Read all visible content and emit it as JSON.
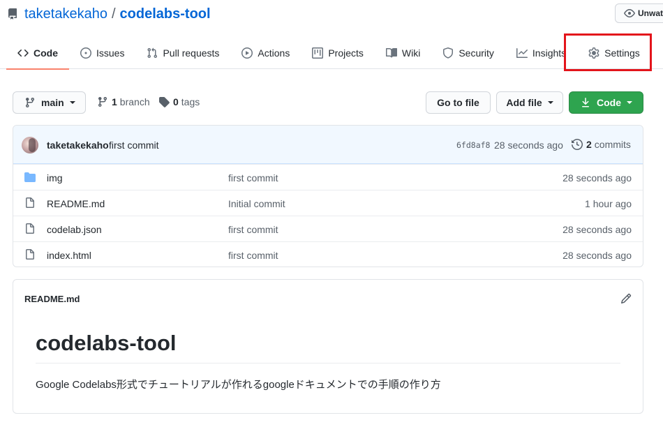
{
  "repo": {
    "owner": "taketakekaho",
    "separator": "/",
    "name": "codelabs-tool",
    "watch_label": "Unwatch"
  },
  "tabs": [
    {
      "label": "Code",
      "icon": "code-icon",
      "active": true
    },
    {
      "label": "Issues",
      "icon": "issue-icon"
    },
    {
      "label": "Pull requests",
      "icon": "pull-request-icon"
    },
    {
      "label": "Actions",
      "icon": "play-icon"
    },
    {
      "label": "Projects",
      "icon": "project-icon"
    },
    {
      "label": "Wiki",
      "icon": "book-icon"
    },
    {
      "label": "Security",
      "icon": "shield-icon"
    },
    {
      "label": "Insights",
      "icon": "graph-icon"
    },
    {
      "label": "Settings",
      "icon": "gear-icon",
      "highlighted": true
    }
  ],
  "toolbar": {
    "branch_label": "main",
    "branch_count": "1",
    "branch_word": "branch",
    "tag_count": "0",
    "tag_word": "tags",
    "goto_file": "Go to file",
    "add_file": "Add file",
    "code_button": "Code"
  },
  "latest_commit": {
    "author": "taketakekaho",
    "message": "first commit",
    "sha": "6fd8af8",
    "time": "28 seconds ago",
    "commit_count": "2",
    "commit_word": "commits"
  },
  "files": [
    {
      "type": "folder",
      "name": "img",
      "message": "first commit",
      "age": "28 seconds ago"
    },
    {
      "type": "file",
      "name": "README.md",
      "message": "Initial commit",
      "age": "1 hour ago"
    },
    {
      "type": "file",
      "name": "codelab.json",
      "message": "first commit",
      "age": "28 seconds ago"
    },
    {
      "type": "file",
      "name": "index.html",
      "message": "first commit",
      "age": "28 seconds ago"
    }
  ],
  "readme": {
    "filename": "README.md",
    "heading": "codelabs-tool",
    "body": "Google Codelabs形式でチュートリアルが作れるgoogleドキュメントでの手順の作り方"
  },
  "colors": {
    "link": "#0366d6",
    "primary_button": "#2ea44f",
    "active_tab_underline": "#f9826c",
    "highlight_box": "#e3141b",
    "commit_bar": "#f1f8ff",
    "folder_icon": "#79b8ff"
  }
}
